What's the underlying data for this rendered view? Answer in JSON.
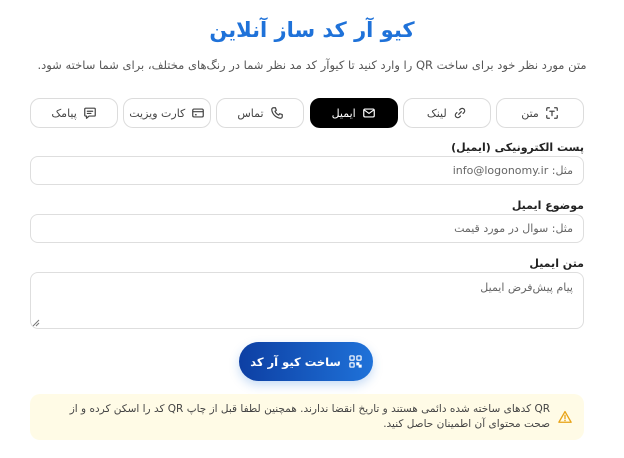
{
  "header": {
    "title": "کیو آر کد ساز آنلاین",
    "subtitle": "متن مورد نظر خود برای ساخت QR را وارد کنید تا کیوآر کد مد نظر شما در رنگ‌های مختلف، برای شما ساخته شود."
  },
  "tabs": [
    {
      "label": "متن",
      "icon": "text-scan-icon"
    },
    {
      "label": "لینک",
      "icon": "link-icon"
    },
    {
      "label": "ایمیل",
      "icon": "mail-icon",
      "active": true
    },
    {
      "label": "تماس",
      "icon": "phone-icon"
    },
    {
      "label": "کارت ویزیت",
      "icon": "card-icon"
    },
    {
      "label": "پیامک",
      "icon": "message-icon"
    }
  ],
  "form": {
    "email_label": "پست الکترونیکی (ایمیل)",
    "email_placeholder": "مثل: info@logonomy.ir",
    "subject_label": "موضوع ایمیل",
    "subject_placeholder": "مثل: سوال در مورد قیمت",
    "body_label": "متن ایمیل",
    "body_placeholder": "پیام پیش‌فرض ایمیل"
  },
  "submit_label": "ساخت کیو آر کد",
  "notice": "QR کدهای ساخته شده دائمی هستند و تاریخ انقضا ندارند. همچنین لطفا قبل از چاپ QR کد را اسکن کرده و از صحت محتوای آن اطمینان حاصل کنید.",
  "colors": {
    "accent": "#1f72d9",
    "active_tab": "#000000",
    "notice_bg": "#fffbe6",
    "warning": "#e8a317"
  }
}
